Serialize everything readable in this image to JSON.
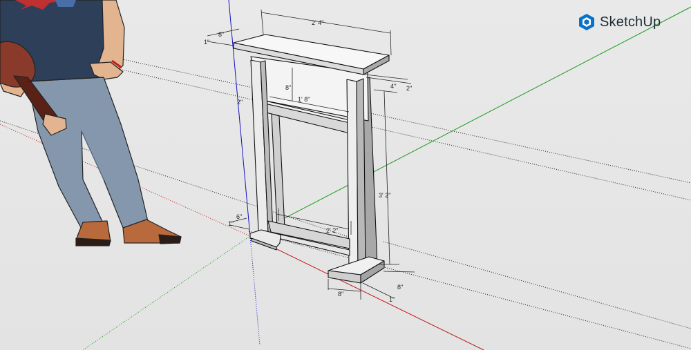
{
  "app": {
    "name": "SketchUp"
  },
  "colors": {
    "axis_red": "#c01818",
    "axis_green": "#1a9a1a",
    "axis_blue": "#1010c0",
    "brand": "#0a72c9"
  },
  "dimensions": {
    "top_width": "2' 4\"",
    "top_depth": "8\"",
    "top_thickness": "1\"",
    "rail_gap": "8\"",
    "inner_width_upper": "1' 8\"",
    "rail_thickness": "2\"",
    "leg_width": "4\"",
    "leg_depth": "2\"",
    "height": "3' 2\"",
    "inner_width_lower": "2' 2\"",
    "foot_depth_left": "6\"",
    "foot_thickness_left": "1\"",
    "foot_width": "8\"",
    "foot_depth_right": "8\"",
    "foot_thickness_right": "1\""
  }
}
